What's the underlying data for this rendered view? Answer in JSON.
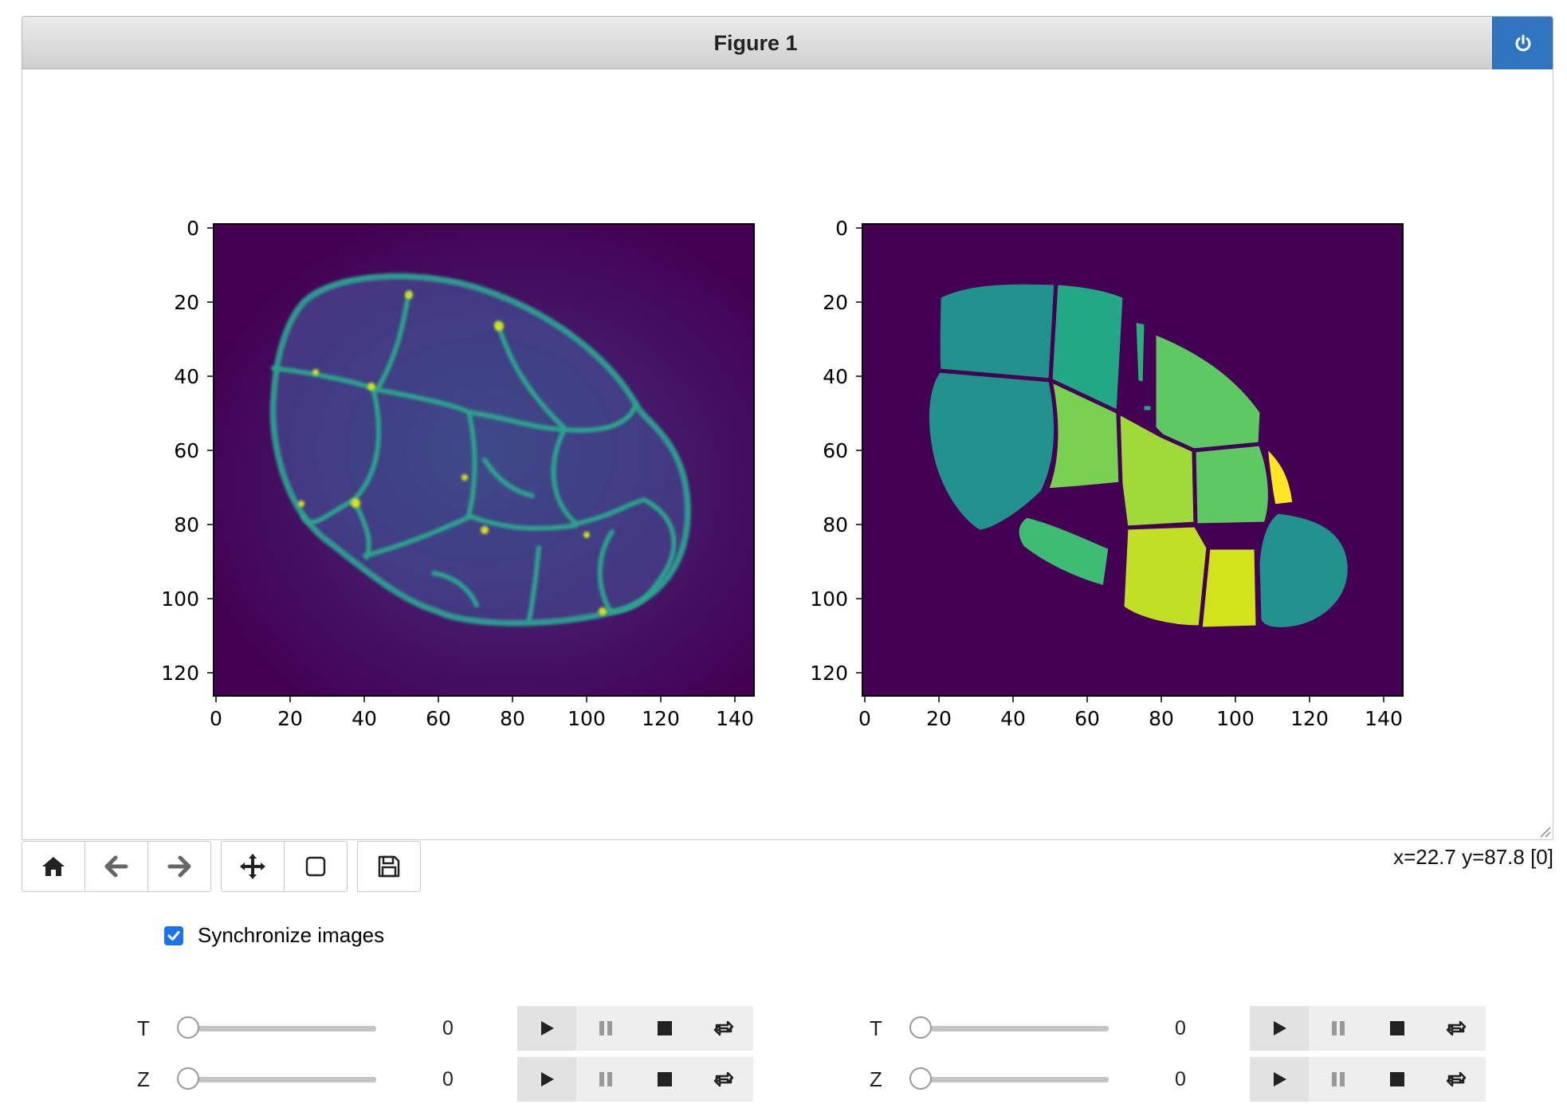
{
  "figure": {
    "title": "Figure 1"
  },
  "colors": {
    "viridis_dark": "#440154",
    "titlebar_button": "#2f75c0",
    "checkbox": "#1a73e8"
  },
  "plots": [
    {
      "name": "raw-image",
      "xticks": [
        "0",
        "20",
        "40",
        "60",
        "80",
        "100",
        "120",
        "140"
      ],
      "yticks": [
        "0",
        "20",
        "40",
        "60",
        "80",
        "100",
        "120"
      ],
      "xlim": [
        0,
        146
      ],
      "ylim": [
        127,
        0
      ]
    },
    {
      "name": "label-image",
      "xticks": [
        "0",
        "20",
        "40",
        "60",
        "80",
        "100",
        "120",
        "140"
      ],
      "yticks": [
        "0",
        "20",
        "40",
        "60",
        "80",
        "100",
        "120"
      ],
      "xlim": [
        0,
        146
      ],
      "ylim": [
        127,
        0
      ]
    }
  ],
  "toolbar": {
    "home": "home-icon",
    "back": "arrow-left-icon",
    "forward": "arrow-right-icon",
    "pan": "move-icon",
    "zoom": "square-icon",
    "save": "floppy-icon"
  },
  "coords_readout": "x=22.7 y=87.8 [0]",
  "sync": {
    "label": "Synchronize images",
    "checked": true
  },
  "controls": {
    "left": {
      "t": {
        "label": "T",
        "value": "0"
      },
      "z": {
        "label": "Z",
        "value": "0"
      }
    },
    "right": {
      "t": {
        "label": "T",
        "value": "0"
      },
      "z": {
        "label": "Z",
        "value": "0"
      }
    }
  }
}
